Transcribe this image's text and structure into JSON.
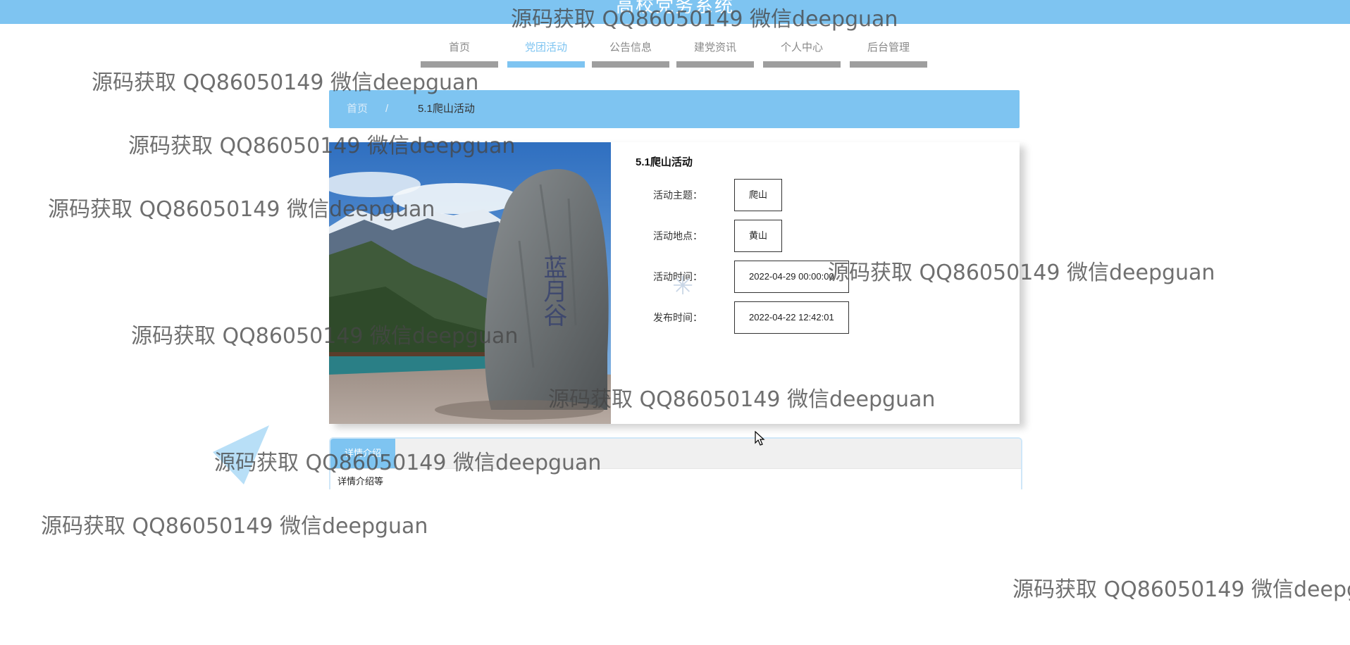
{
  "site": {
    "title": "高校党务系统"
  },
  "nav": {
    "items": [
      {
        "label": "首页",
        "active": false
      },
      {
        "label": "党团活动",
        "active": true
      },
      {
        "label": "公告信息",
        "active": false
      },
      {
        "label": "建党资讯",
        "active": false
      },
      {
        "label": "个人中心",
        "active": false
      },
      {
        "label": "后台管理",
        "active": false
      }
    ]
  },
  "breadcrumb": {
    "home": "首页",
    "separator": "/",
    "current": "5.1爬山活动"
  },
  "detail": {
    "title": "5.1爬山活动",
    "fields": [
      {
        "label": "活动主题：",
        "value": "爬山"
      },
      {
        "label": "活动地点：",
        "value": "黄山"
      },
      {
        "label": "活动时间：",
        "value": "2022-04-29 00:00:00"
      },
      {
        "label": "发布时间：",
        "value": "2022-04-22 12:42:01"
      }
    ],
    "photo_icon": "mountain-landscape-photo"
  },
  "tabs": {
    "active_label": "详情介绍",
    "content": "详情介绍等"
  },
  "watermark": {
    "text": "源码获取 QQ86050149 微信deepguan",
    "text_cut": "源码获取 QQ86050149 微信deepg"
  },
  "colors": {
    "primary": "#7ec4f1",
    "nav_bar": "#9e9e9e"
  }
}
